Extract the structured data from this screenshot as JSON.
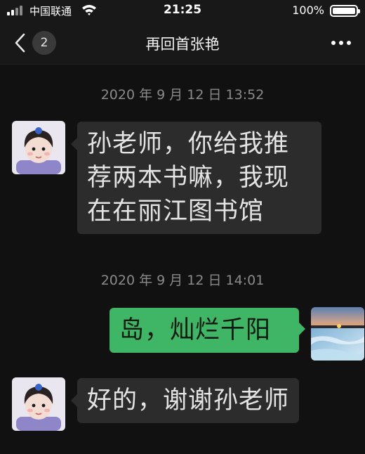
{
  "status_bar": {
    "carrier": "中国联通",
    "time": "21:25",
    "battery": "100%"
  },
  "header": {
    "unread_count": "2",
    "title": "再回首张艳"
  },
  "messages": [
    {
      "type": "timestamp",
      "text": "2020 年 9 月 12 日 13:52"
    },
    {
      "type": "incoming",
      "sender_avatar": "child-avatar",
      "text": "孙老师，你给我推荐两本书嘛，我现在在丽江图书馆"
    },
    {
      "type": "timestamp",
      "text": "2020 年 9 月 12 日 14:01"
    },
    {
      "type": "outgoing",
      "sender_avatar": "sunset-landscape-avatar",
      "text": "岛，灿烂千阳"
    },
    {
      "type": "incoming",
      "sender_avatar": "child-avatar",
      "text": "好的，谢谢孙老师"
    }
  ],
  "colors": {
    "background": "#111111",
    "bar": "#181818",
    "incoming_bubble": "#2c2c2c",
    "outgoing_bubble": "#3fb666",
    "timestamp": "#8a8a8a"
  }
}
